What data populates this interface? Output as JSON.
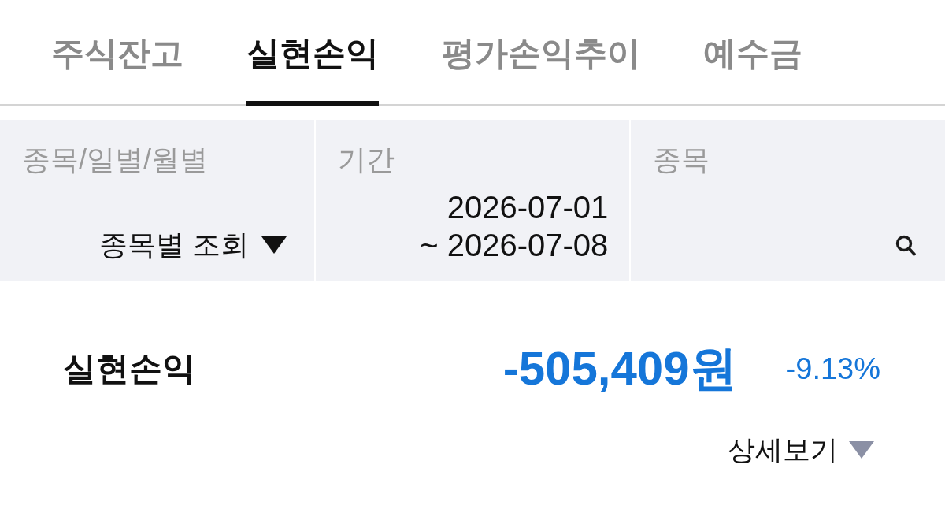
{
  "tabs": [
    {
      "label": "주식잔고",
      "selected": false
    },
    {
      "label": "실현손익",
      "selected": true
    },
    {
      "label": "평가손익추이",
      "selected": false
    },
    {
      "label": "예수금",
      "selected": false
    }
  ],
  "filters": [
    {
      "kind": "dropdown",
      "label": "종목/일별/월별",
      "value": "종목별 조회"
    },
    {
      "kind": "date_range",
      "label": "기간",
      "start": "2026-07-01",
      "end": "~ 2026-07-08"
    },
    {
      "kind": "search",
      "label": "종목"
    }
  ],
  "summary": {
    "label": "실현손익",
    "amount": "-505,409원",
    "rate": "-9.13%"
  },
  "details_toggle": {
    "label": "상세보기",
    "expanded": false
  }
}
